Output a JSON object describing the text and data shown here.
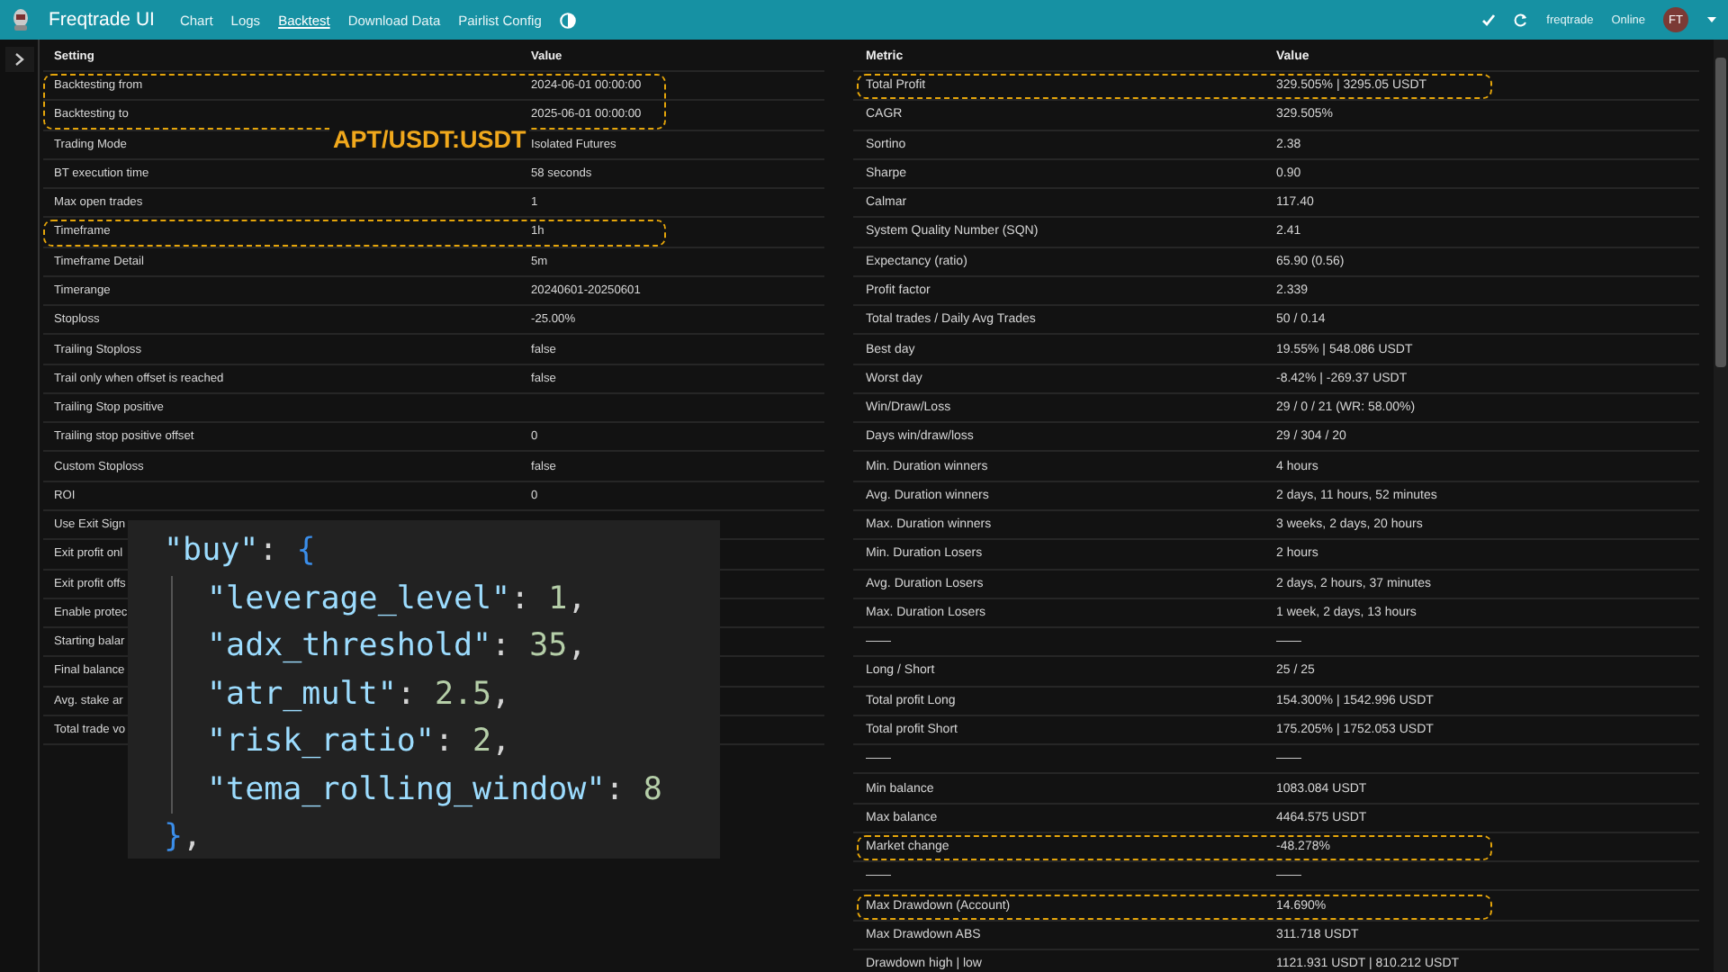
{
  "navbar": {
    "brand": "Freqtrade UI",
    "items": [
      {
        "label": "Chart",
        "selected": false
      },
      {
        "label": "Logs",
        "selected": false
      },
      {
        "label": "Backtest",
        "selected": true
      },
      {
        "label": "Download Data",
        "selected": false
      },
      {
        "label": "Pairlist Config",
        "selected": false
      }
    ],
    "bot_name": "freqtrade",
    "status": "Online",
    "avatar": "FT"
  },
  "settings_table": {
    "columns": [
      "Setting",
      "Value"
    ],
    "rows": [
      {
        "label": "Backtesting from",
        "value": "2024-06-01 00:00:00",
        "highlighted": true
      },
      {
        "label": "Backtesting to",
        "value": "2025-06-01 00:00:00",
        "highlighted": true
      },
      {
        "label": "Trading Mode",
        "value": "Isolated Futures",
        "highlighted": false
      },
      {
        "label": "BT execution time",
        "value": "58 seconds",
        "highlighted": false
      },
      {
        "label": "Max open trades",
        "value": "1",
        "highlighted": false
      },
      {
        "label": "Timeframe",
        "value": "1h",
        "highlighted": true
      },
      {
        "label": "Timeframe Detail",
        "value": "5m",
        "highlighted": false
      },
      {
        "label": "Timerange",
        "value": "20240601-20250601",
        "highlighted": false
      },
      {
        "label": "Stoploss",
        "value": "-25.00%",
        "highlighted": false
      },
      {
        "label": "Trailing Stoploss",
        "value": "false",
        "highlighted": false
      },
      {
        "label": "Trail only when offset is reached",
        "value": "false",
        "highlighted": false
      },
      {
        "label": "Trailing Stop positive",
        "highlighted": false
      },
      {
        "label": "Trailing stop positive offset",
        "value": "0",
        "highlighted": false
      },
      {
        "label": "Custom Stoploss",
        "value": "false",
        "highlighted": false
      },
      {
        "label": "ROI",
        "value": "0",
        "highlighted": false
      },
      {
        "label": "Use Exit Sign",
        "highlighted": false
      },
      {
        "label": "Exit profit onl",
        "highlighted": false
      },
      {
        "label": "Exit profit offs",
        "highlighted": false
      },
      {
        "label": "Enable protec",
        "highlighted": false
      },
      {
        "label": "Starting balar",
        "highlighted": false
      },
      {
        "label": "Final balance",
        "highlighted": false
      },
      {
        "label": "Avg. stake ar",
        "highlighted": false
      },
      {
        "label": "Total trade vo",
        "highlighted": false
      }
    ]
  },
  "pair_label": "APT/USDT:USDT",
  "code_overlay": {
    "lines": [
      {
        "kind": "open",
        "tokens": [
          {
            "text": "\"buy\"",
            "kind": "key"
          },
          {
            "text": ": ",
            "kind": "punct"
          },
          {
            "text": "{",
            "kind": "brace"
          }
        ]
      },
      {
        "kind": "member",
        "tokens": [
          {
            "text": "\"leverage_level\"",
            "kind": "key"
          },
          {
            "text": ": ",
            "kind": "punct"
          },
          {
            "text": "1",
            "kind": "number"
          },
          {
            "text": ",",
            "kind": "punct"
          }
        ]
      },
      {
        "kind": "member",
        "tokens": [
          {
            "text": "\"adx_threshold\"",
            "kind": "key"
          },
          {
            "text": ": ",
            "kind": "punct"
          },
          {
            "text": "35",
            "kind": "number"
          },
          {
            "text": ",",
            "kind": "punct"
          }
        ]
      },
      {
        "kind": "member",
        "tokens": [
          {
            "text": "\"atr_mult\"",
            "kind": "key"
          },
          {
            "text": ": ",
            "kind": "punct"
          },
          {
            "text": "2.5",
            "kind": "number"
          },
          {
            "text": ",",
            "kind": "punct"
          }
        ]
      },
      {
        "kind": "member",
        "tokens": [
          {
            "text": "\"risk_ratio\"",
            "kind": "key"
          },
          {
            "text": ": ",
            "kind": "punct"
          },
          {
            "text": "2",
            "kind": "number"
          },
          {
            "text": ",",
            "kind": "punct"
          }
        ]
      },
      {
        "kind": "member",
        "tokens": [
          {
            "text": "\"tema_rolling_window\"",
            "kind": "key"
          },
          {
            "text": ": ",
            "kind": "punct"
          },
          {
            "text": "8",
            "kind": "number"
          }
        ]
      },
      {
        "kind": "close",
        "tokens": [
          {
            "text": "}",
            "kind": "brace"
          },
          {
            "text": ",",
            "kind": "punct"
          }
        ]
      }
    ]
  },
  "metrics_table": {
    "columns": [
      "Metric",
      "Value"
    ],
    "rows": [
      {
        "label": "Total Profit",
        "value": "329.505% | 3295.05 USDT",
        "highlighted": true
      },
      {
        "label": "CAGR",
        "value": "329.505%",
        "highlighted": false
      },
      {
        "label": "Sortino",
        "value": "2.38",
        "highlighted": false
      },
      {
        "label": "Sharpe",
        "value": "0.90",
        "highlighted": false
      },
      {
        "label": "Calmar",
        "value": "117.40",
        "highlighted": false
      },
      {
        "label": "System Quality Number (SQN)",
        "value": "2.41",
        "highlighted": false
      },
      {
        "label": "Expectancy (ratio)",
        "value": "65.90 (0.56)",
        "highlighted": false
      },
      {
        "label": "Profit factor",
        "value": "2.339",
        "highlighted": false
      },
      {
        "label": "Total trades / Daily Avg Trades",
        "value": "50 / 0.14",
        "highlighted": false
      },
      {
        "label": "Best day",
        "value": "19.55% | 548.086 USDT",
        "highlighted": false
      },
      {
        "label": "Worst day",
        "value": "-8.42% | -269.37 USDT",
        "highlighted": false
      },
      {
        "label": "Win/Draw/Loss",
        "value": "29 / 0 / 21 (WR: 58.00%)",
        "highlighted": false
      },
      {
        "label": "Days win/draw/loss",
        "value": "29 / 304 / 20",
        "highlighted": false
      },
      {
        "label": "Min. Duration winners",
        "value": "4 hours",
        "highlighted": false
      },
      {
        "label": "Avg. Duration winners",
        "value": "2 days, 11 hours, 52 minutes",
        "highlighted": false
      },
      {
        "label": "Max. Duration winners",
        "value": "3 weeks, 2 days, 20 hours",
        "highlighted": false
      },
      {
        "label": "Min. Duration Losers",
        "value": "2 hours",
        "highlighted": false
      },
      {
        "label": "Avg. Duration Losers",
        "value": "2 days, 2 hours, 37 minutes",
        "highlighted": false
      },
      {
        "label": "Max. Duration Losers",
        "value": "1 week, 2 days, 13 hours",
        "highlighted": false
      },
      {
        "label": "——",
        "value": "——",
        "highlighted": false
      },
      {
        "label": "Long / Short",
        "value": "25 / 25",
        "highlighted": false
      },
      {
        "label": "Total profit Long",
        "value": "154.300% | 1542.996 USDT",
        "highlighted": false
      },
      {
        "label": "Total profit Short",
        "value": "175.205% | 1752.053 USDT",
        "highlighted": false
      },
      {
        "label": "——",
        "value": "——",
        "highlighted": false
      },
      {
        "label": "Min balance",
        "value": "1083.084 USDT",
        "highlighted": false
      },
      {
        "label": "Max balance",
        "value": "4464.575 USDT",
        "highlighted": false
      },
      {
        "label": "Market change",
        "value": "-48.278%",
        "highlighted": true
      },
      {
        "label": "——",
        "value": "——",
        "highlighted": false
      },
      {
        "label": "Max Drawdown (Account)",
        "value": "14.690%",
        "highlighted": true
      },
      {
        "label": "Max Drawdown ABS",
        "value": "311.718 USDT",
        "highlighted": false
      },
      {
        "label": "Drawdown high | low",
        "value": "1121.931 USDT | 810.212 USDT",
        "highlighted": false
      }
    ]
  }
}
